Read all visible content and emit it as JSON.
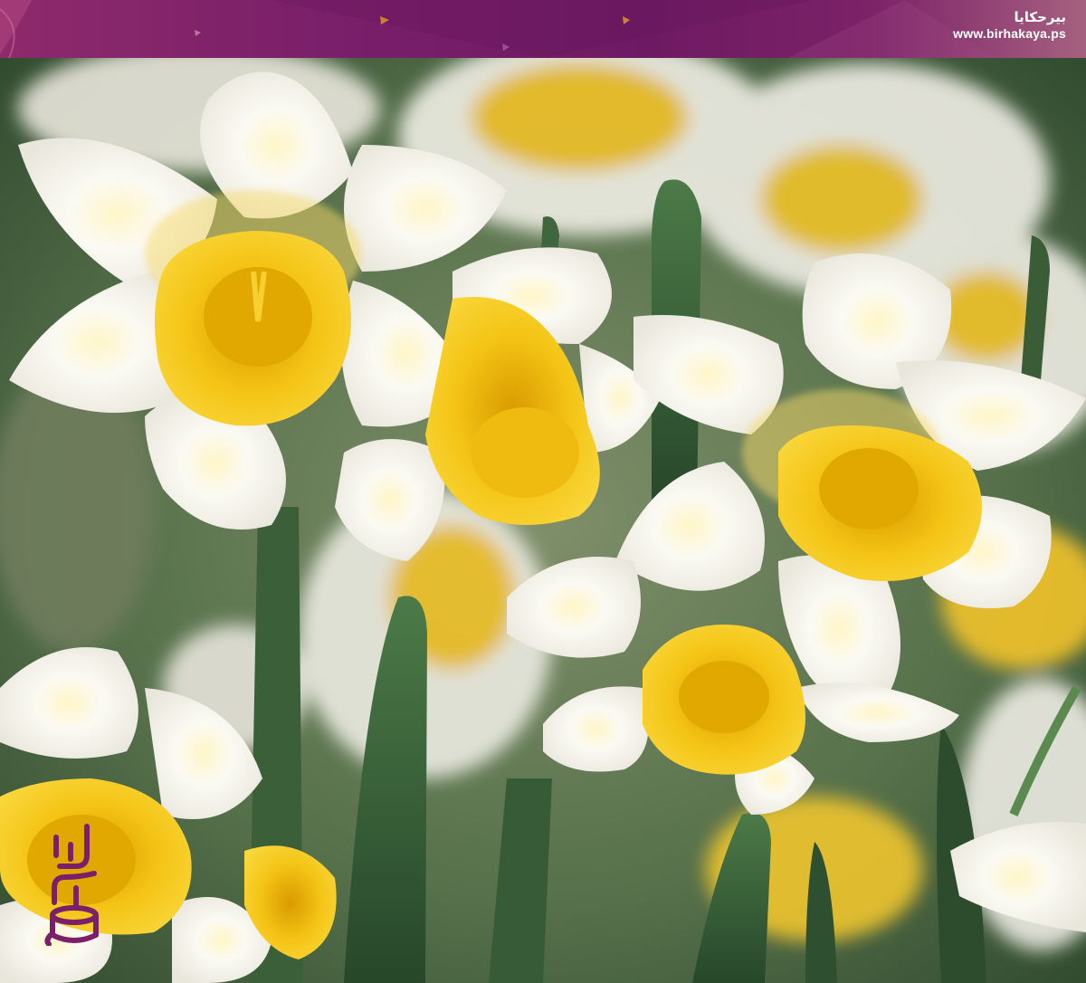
{
  "banner": {
    "brand_name": "بيرحكايا",
    "brand_url": "www.birhakaya.ps",
    "colors": {
      "primary": "#7a1f6a",
      "accent": "#f5a623"
    }
  },
  "photo": {
    "subject": "daffodil-flowers",
    "colors": {
      "petal": "#f6f4ec",
      "trumpet": "#f2c014",
      "leaf": "#3f6b3c"
    }
  },
  "logo": {
    "icon": "birhakaya-logo-icon",
    "color": "#7a1f6a"
  }
}
